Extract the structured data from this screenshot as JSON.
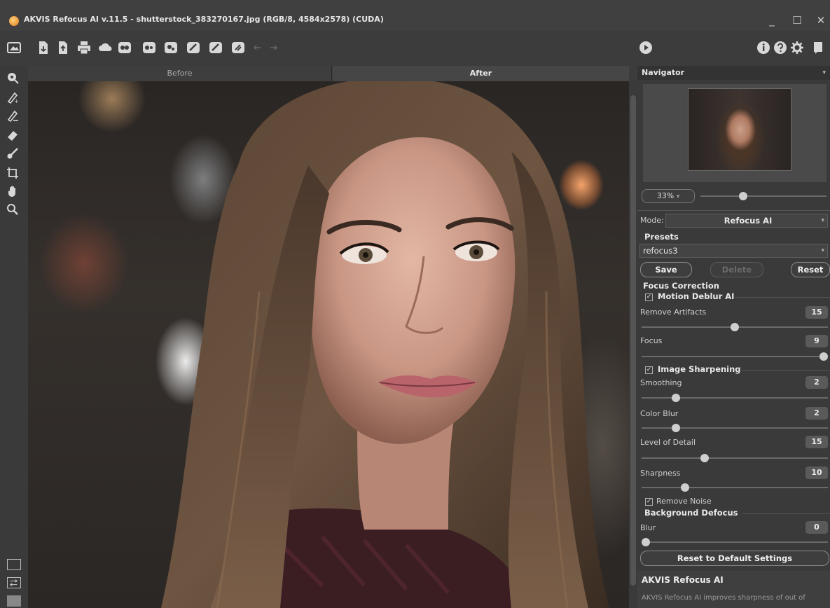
{
  "window": {
    "title": "AKVIS Refocus AI v.11.5 - shutterstock_383270167.jpg (RGB/8, 4584x2578) (CUDA)",
    "minimize": "_",
    "maximize": "☐",
    "close": "✕"
  },
  "toolbar": {
    "icons": [
      "open-icon",
      "save-icon",
      "save-as-icon",
      "print-icon",
      "share-icon",
      "batch-icon",
      "preset-icon",
      "mask-icon",
      "undo-icon",
      "redo-icon",
      "reset-icon"
    ],
    "run": "▶",
    "info": "i",
    "help": "?",
    "settings": "⚙",
    "notes": "▮"
  },
  "tabs": {
    "before": "Before",
    "after": "After",
    "active": "after"
  },
  "toolbox": {
    "tools": [
      "focus-tool-icon",
      "keep-pencil-icon",
      "remove-pencil-icon",
      "eraser-icon",
      "brush-icon",
      "crop-icon",
      "hand-icon",
      "zoom-icon"
    ]
  },
  "navigator": {
    "title": "Navigator",
    "zoom": "33%",
    "zoom_fraction": 0.33
  },
  "settings": {
    "mode_label": "Mode:",
    "mode_value": "Refocus AI",
    "presets_label": "Presets",
    "preset_value": "refocus3",
    "save": "Save",
    "delete": "Delete",
    "reset": "Reset",
    "focus_correction": "Focus Correction",
    "motion_deblur": "Motion Deblur AI",
    "remove_artifacts": {
      "label": "Remove Artifacts",
      "value": "15",
      "level": 0.5
    },
    "focus": {
      "label": "Focus",
      "value": "9",
      "level": 1.0
    },
    "image_sharpening": "Image Sharpening",
    "smoothing": {
      "label": "Smoothing",
      "value": "2",
      "level": 0.17
    },
    "color_blur": {
      "label": "Color Blur",
      "value": "2",
      "level": 0.17
    },
    "level_of_detail": {
      "label": "Level of Detail",
      "value": "15",
      "level": 0.33
    },
    "sharpness": {
      "label": "Sharpness",
      "value": "10",
      "level": 0.22
    },
    "remove_noise": "Remove Noise",
    "background_defocus": "Background Defocus",
    "blur": {
      "label": "Blur",
      "value": "0",
      "level": 0.0
    },
    "reset_default": "Reset to Default Settings"
  },
  "help": {
    "title": "AKVIS Refocus AI",
    "text": "AKVIS Refocus AI improves sharpness of out of"
  },
  "colors": {
    "accent": "#cfcfcf",
    "panel": "#3a3a3a"
  }
}
